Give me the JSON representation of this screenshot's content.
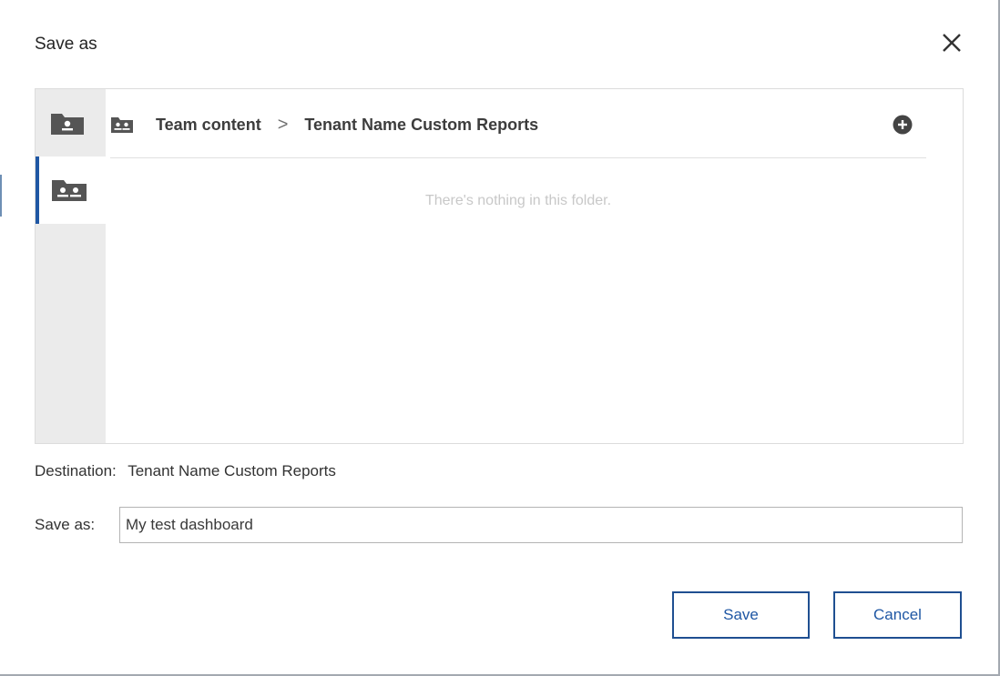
{
  "dialog": {
    "title": "Save as",
    "close_icon": "close-icon"
  },
  "navigator": {
    "side_items": [
      {
        "icon": "my-content-folder-icon"
      },
      {
        "icon": "team-content-folder-icon",
        "selected": true
      }
    ],
    "breadcrumb": {
      "icon": "team-folder-icon",
      "items": [
        "Team content",
        "Tenant Name Custom Reports"
      ],
      "separator": ">"
    },
    "add_icon": "add-circle-icon",
    "empty_message": "There's nothing in this folder."
  },
  "destination": {
    "label": "Destination:",
    "value": "Tenant Name Custom Reports"
  },
  "save_as": {
    "label": "Save as:",
    "value": "My test dashboard",
    "placeholder": ""
  },
  "buttons": {
    "save_label": "Save",
    "cancel_label": "Cancel"
  },
  "colors": {
    "accent": "#1f57a4",
    "icon_gray": "#555555",
    "sidebar_bg": "#ebebeb"
  }
}
